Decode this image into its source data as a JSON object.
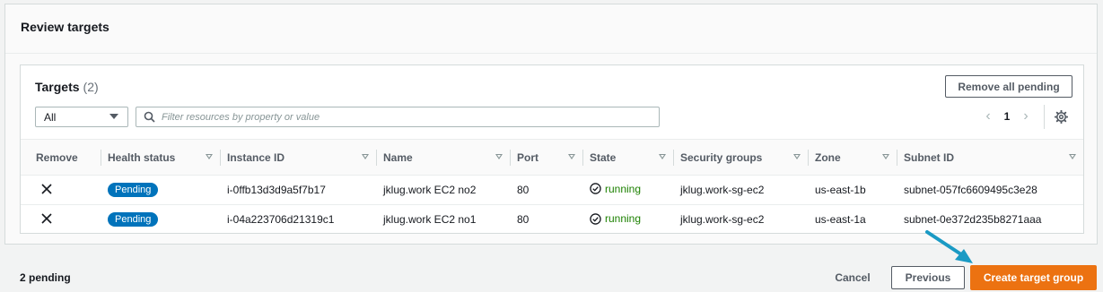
{
  "section": {
    "title": "Review targets"
  },
  "targets": {
    "title": "Targets",
    "count": "(2)",
    "remove_all_label": "Remove all pending",
    "filter_select": "All",
    "search_placeholder": "Filter resources by property or value",
    "page_number": "1"
  },
  "table": {
    "headers": [
      "Remove",
      "Health status",
      "Instance ID",
      "Name",
      "Port",
      "State",
      "Security groups",
      "Zone",
      "Subnet ID"
    ],
    "rows": [
      {
        "health": "Pending",
        "instance_id": "i-0ffb13d3d9a5f7b17",
        "name": "jklug.work EC2 no2",
        "port": "80",
        "state": "running",
        "security_group": "jklug.work-sg-ec2",
        "zone": "us-east-1b",
        "subnet": "subnet-057fc6609495c3e28"
      },
      {
        "health": "Pending",
        "instance_id": "i-04a223706d21319c1",
        "name": "jklug.work EC2 no1",
        "port": "80",
        "state": "running",
        "security_group": "jklug.work-sg-ec2",
        "zone": "us-east-1a",
        "subnet": "subnet-0e372d235b8271aaa"
      }
    ]
  },
  "footer": {
    "pending_count": "2 pending",
    "cancel_label": "Cancel",
    "previous_label": "Previous",
    "create_label": "Create target group"
  },
  "colors": {
    "primary": "#ec7211",
    "badge": "#0073bb",
    "running": "#1d8102",
    "annotation_arrow": "#1a9ac4"
  }
}
